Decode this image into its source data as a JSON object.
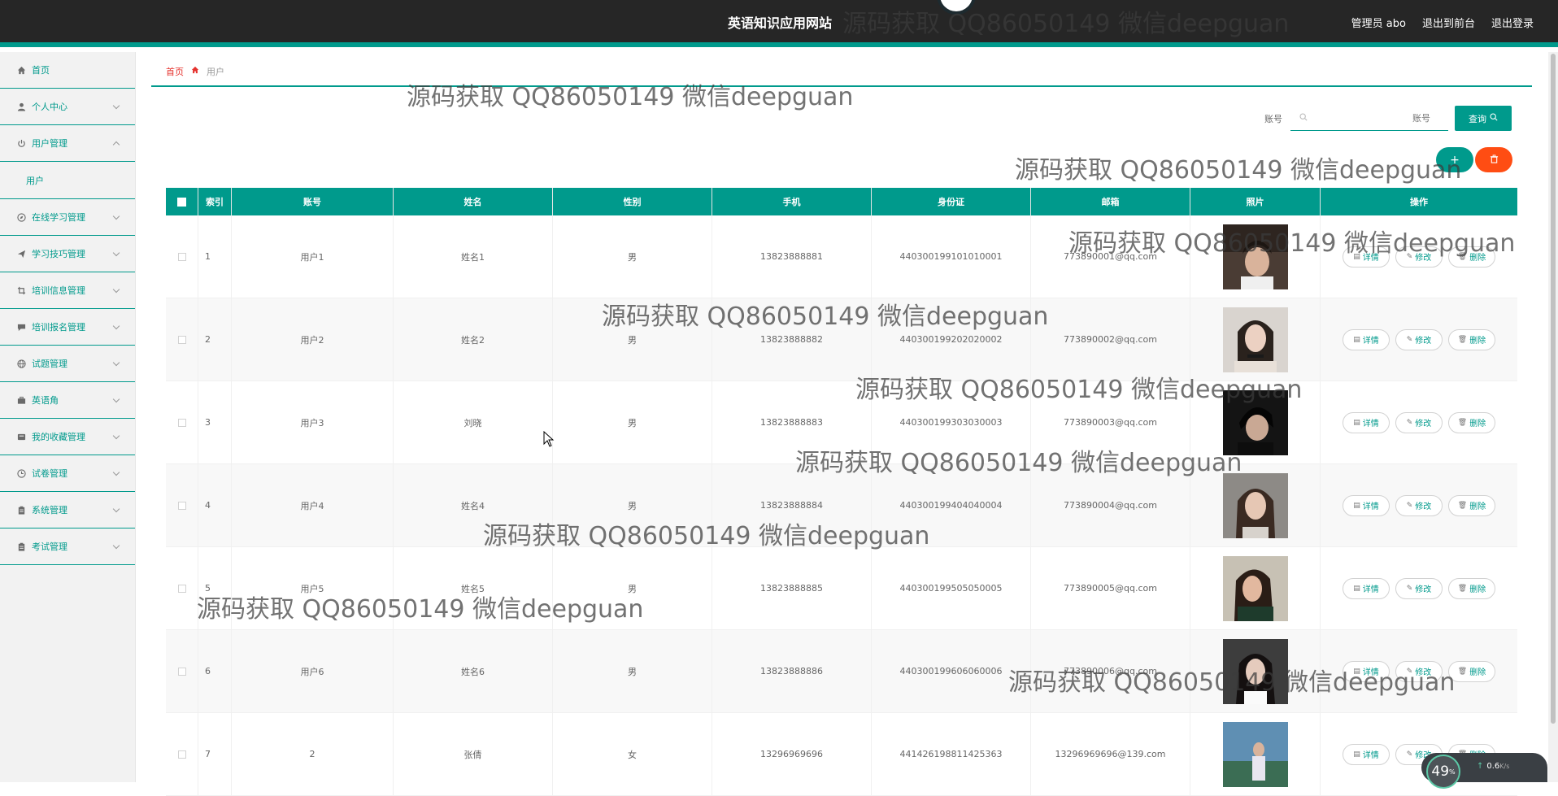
{
  "header": {
    "site_title": "英语知识应用网站",
    "nav": [
      "管理员 abo",
      "退出到前台",
      "退出登录"
    ]
  },
  "sidebar": {
    "items": [
      {
        "label": "首页",
        "icon": "home-icon",
        "expandable": false
      },
      {
        "label": "个人中心",
        "icon": "user-icon",
        "expandable": true
      },
      {
        "label": "用户管理",
        "icon": "power-icon",
        "expandable": true,
        "expanded": true,
        "children": [
          "用户"
        ]
      },
      {
        "label": "在线学习管理",
        "icon": "compass-icon",
        "expandable": true
      },
      {
        "label": "学习技巧管理",
        "icon": "send-icon",
        "expandable": true
      },
      {
        "label": "培训信息管理",
        "icon": "crop-icon",
        "expandable": true
      },
      {
        "label": "培训报名管理",
        "icon": "chat-icon",
        "expandable": true
      },
      {
        "label": "试题管理",
        "icon": "globe-icon",
        "expandable": true
      },
      {
        "label": "英语角",
        "icon": "briefcase-icon",
        "expandable": true
      },
      {
        "label": "我的收藏管理",
        "icon": "album-icon",
        "expandable": true
      },
      {
        "label": "试卷管理",
        "icon": "clock-icon",
        "expandable": true
      },
      {
        "label": "系统管理",
        "icon": "clipboard-icon",
        "expandable": true
      },
      {
        "label": "考试管理",
        "icon": "clipboard-icon",
        "expandable": true
      }
    ]
  },
  "breadcrumb": {
    "home": "首页",
    "current": "用户"
  },
  "search": {
    "label": "账号",
    "placeholder": "账号",
    "button": "查询"
  },
  "actions": {
    "add": "+",
    "delete_icon": "trash-icon"
  },
  "table": {
    "headers": [
      "索引",
      "账号",
      "姓名",
      "性别",
      "手机",
      "身份证",
      "邮箱",
      "照片",
      "操作"
    ],
    "rows": [
      {
        "index": "1",
        "account": "用户1",
        "name": "姓名1",
        "gender": "男",
        "phone": "13823888881",
        "id_card": "440300199101010001",
        "email": "773890001@qq.com"
      },
      {
        "index": "2",
        "account": "用户2",
        "name": "姓名2",
        "gender": "男",
        "phone": "13823888882",
        "id_card": "440300199202020002",
        "email": "773890002@qq.com"
      },
      {
        "index": "3",
        "account": "用户3",
        "name": "刘晓",
        "gender": "男",
        "phone": "13823888883",
        "id_card": "440300199303030003",
        "email": "773890003@qq.com"
      },
      {
        "index": "4",
        "account": "用户4",
        "name": "姓名4",
        "gender": "男",
        "phone": "13823888884",
        "id_card": "440300199404040004",
        "email": "773890004@qq.com"
      },
      {
        "index": "5",
        "account": "用户5",
        "name": "姓名5",
        "gender": "男",
        "phone": "13823888885",
        "id_card": "440300199505050005",
        "email": "773890005@qq.com"
      },
      {
        "index": "6",
        "account": "用户6",
        "name": "姓名6",
        "gender": "男",
        "phone": "13823888886",
        "id_card": "440300199606060006",
        "email": "773890006@qq.com"
      },
      {
        "index": "7",
        "account": "2",
        "name": "张倩",
        "gender": "女",
        "phone": "13296969696",
        "id_card": "441426198811425363",
        "email": "13296969696@139.com"
      }
    ],
    "row_actions": [
      "详情",
      "修改",
      "删除"
    ]
  },
  "watermark": "源码获取 QQ86050149 微信deepguan",
  "speed_widget": {
    "percent": "49",
    "percent_unit": "%",
    "rate": "0.6",
    "rate_unit": "K/s"
  },
  "colors": {
    "accent": "#009a8c",
    "danger": "#ff4d13",
    "header_bg": "#262626",
    "breadcrumb_home": "#e5322d"
  }
}
